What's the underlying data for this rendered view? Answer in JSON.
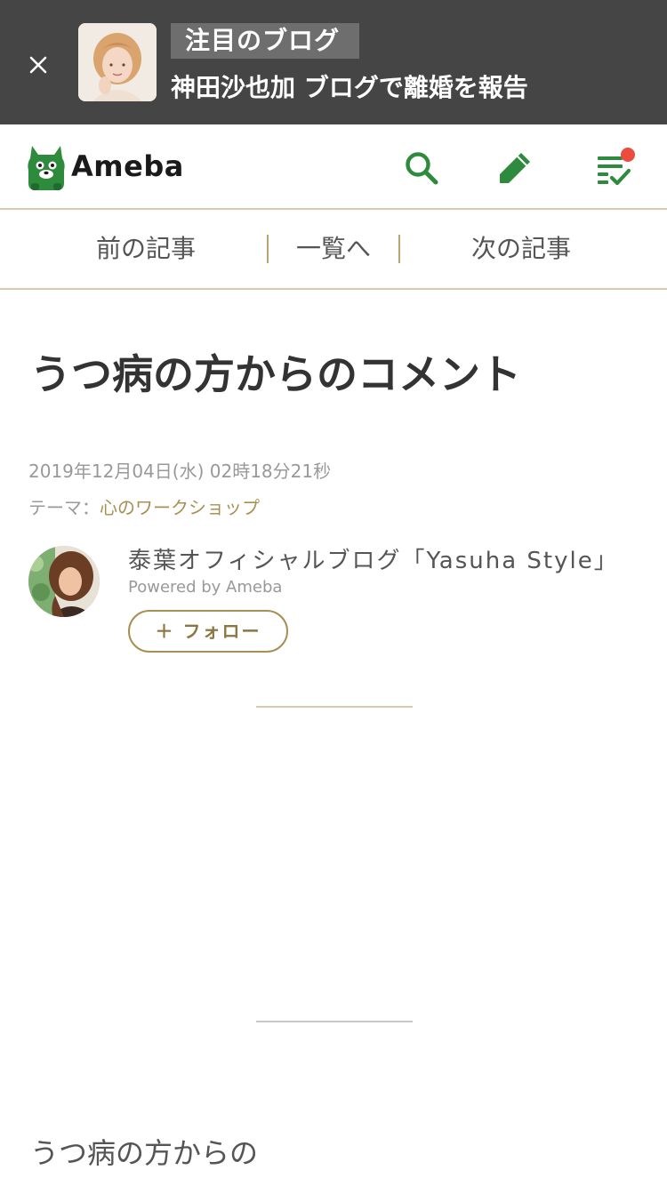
{
  "promo": {
    "tag": "注目のブログ",
    "headline": "神田沙也加 ブログで離婚を報告"
  },
  "header": {
    "logo_text": "Ameba",
    "has_notification": true
  },
  "article_nav": {
    "prev": "前の記事",
    "list": "一覧へ",
    "next": "次の記事"
  },
  "article": {
    "title": "うつ病の方からのコメント",
    "date": "2019年12月04日(水) 02時18分21秒",
    "theme_label": "テーマ：",
    "theme_value": "心のワークショップ",
    "body_start": "うつ病の方からの"
  },
  "author": {
    "blog_name": "泰葉オフィシャルブログ「Yasuha Style」",
    "powered_by": "Powered by Ameba",
    "follow_label": "＋ フォロー"
  },
  "colors": {
    "accent_green": "#2e8b3e",
    "gold": "#a88f54",
    "banner_bg": "#454545",
    "notification": "#ec4b3f"
  }
}
